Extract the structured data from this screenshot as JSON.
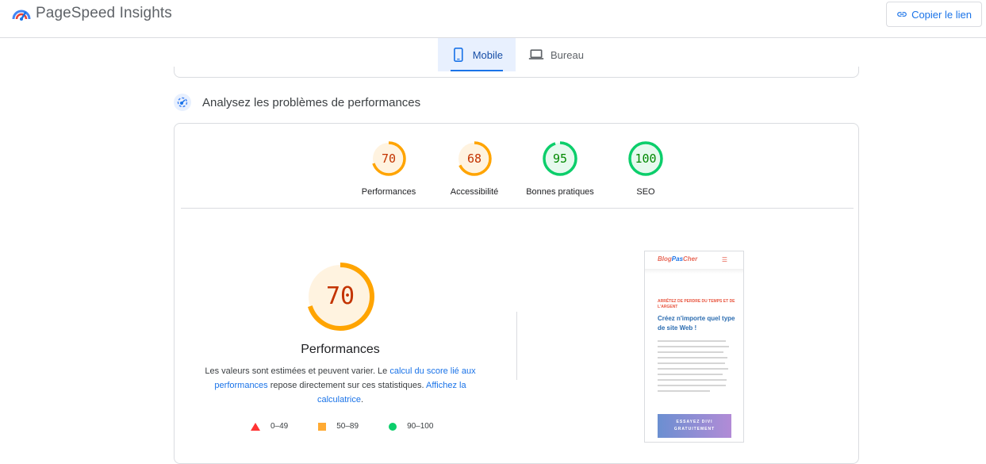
{
  "header": {
    "app_title": "PageSpeed Insights",
    "logo_icon": "pagespeed-logo-icon",
    "copy_button_label": "Copier le lien",
    "copy_icon": "link-icon"
  },
  "device_tabs": [
    {
      "label": "Mobile",
      "icon": "smartphone-icon",
      "active": true
    },
    {
      "label": "Bureau",
      "icon": "laptop-icon",
      "active": false
    }
  ],
  "section": {
    "title": "Analysez les problèmes de performances",
    "icon": "lighthouse-icon"
  },
  "scores": [
    {
      "label": "Performances",
      "value": "70",
      "fraction": 0.7,
      "color": "#ffa400",
      "text_color": "#c33300",
      "bg": "#fff3e0"
    },
    {
      "label": "Accessibilité",
      "value": "68",
      "fraction": 0.68,
      "color": "#ffa400",
      "text_color": "#c33300",
      "bg": "#fff3e0"
    },
    {
      "label": "Bonnes pratiques",
      "value": "95",
      "fraction": 0.95,
      "color": "#0cce6b",
      "text_color": "#008800",
      "bg": "#e6f9ee"
    },
    {
      "label": "SEO",
      "value": "100",
      "fraction": 1.0,
      "color": "#0cce6b",
      "text_color": "#008800",
      "bg": "#e6f9ee"
    }
  ],
  "main_score": {
    "value": "70",
    "fraction": 0.7,
    "label": "Performances",
    "color": "#ffa400",
    "text_color": "#c33300"
  },
  "description": {
    "part1": "Les valeurs sont estimées et peuvent varier. Le ",
    "link1": "calcul du score lié aux performances",
    "part2": " repose directement sur ces statistiques. ",
    "link2": "Affichez la calculatrice",
    "part3": "."
  },
  "legend": [
    {
      "range": "0–49",
      "shape": "triangle",
      "color": "#ff3333"
    },
    {
      "range": "50–89",
      "shape": "square",
      "color": "#ffaa33"
    },
    {
      "range": "90–100",
      "shape": "circle",
      "color": "#0cce6b"
    }
  ],
  "preview": {
    "brand_part1": "Blog",
    "brand_part2": "Pas",
    "brand_part3": "Cher",
    "menu_icon": "hamburger-menu-icon",
    "kicker": "ARRÊTEZ DE PERDRE DU TEMPS ET DE L'ARGENT",
    "headline": "Créez n'importe quel type de site Web !",
    "cta": "ESSAYEZ DIVI GRATUITEMENT"
  }
}
